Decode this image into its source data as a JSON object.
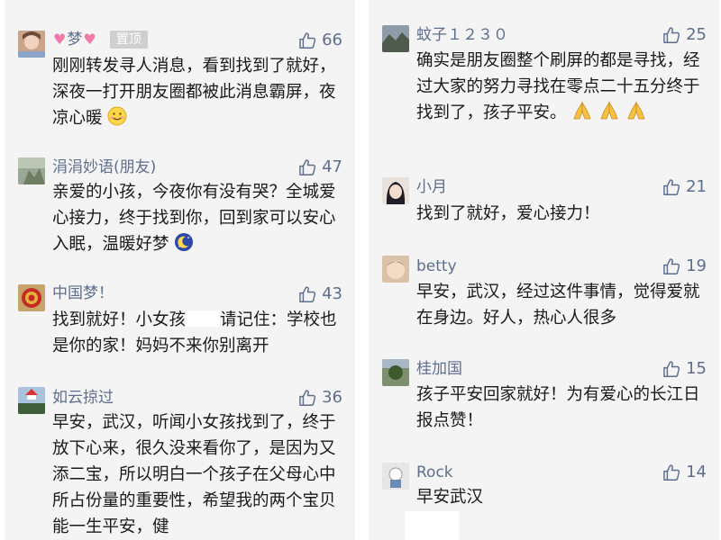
{
  "colors": {
    "panel_bg": "#f4f4f4",
    "name": "#5f6e8c",
    "text": "#1a1a1a",
    "tag_bg": "#cfcfcf",
    "heart": "#f07aa8"
  },
  "left": {
    "comments": [
      {
        "name": "梦",
        "tag": "置顶",
        "likes": "66",
        "text": "刚刚转发寻人消息，看到找到了就好，深夜一打开朋友圈都被此消息霸屏，夜凉心暖",
        "emoji": "smile-emoji"
      },
      {
        "name": "涓涓妙语(朋友)",
        "likes": "47",
        "text": "亲爱的小孩，今夜你有没有哭？全城爱心接力，终于找到你，回到家可以安心入眠，温暖好梦",
        "emoji": "moon-emoji"
      },
      {
        "name": "中国梦！",
        "likes": "43",
        "text_a": "找到就好！小女孩",
        "text_b": "请记住：学校也是你的家！妈妈不来你别离开"
      },
      {
        "name": "如云掠过",
        "likes": "36",
        "text": "早安，武汉，听闻小女孩找到了，终于放下心来，很久没来看你了，是因为又添二宝，所以明白一个孩子在父母心中所占份量的重要性，希望我的两个宝贝能一生平安，健"
      }
    ]
  },
  "right": {
    "comments": [
      {
        "name": "蚊子１２３０",
        "likes": "25",
        "text": "确实是朋友圈整个刷屏的都是寻找，经过大家的努力寻找在零点二十五分终于找到了，孩子平安。",
        "emoji": "pray-emoji"
      },
      {
        "name": "小月",
        "likes": "21",
        "text": "找到了就好，爱心接力！"
      },
      {
        "name": "betty",
        "likes": "19",
        "text": "早安，武汉，经过这件事情，觉得爱就在身边。好人，热心人很多"
      },
      {
        "name": "桂加国",
        "likes": "15",
        "text": "孩子平安回家就好！为有爱心的长江日报点赞！"
      },
      {
        "name": "Rock",
        "likes": "14",
        "text": "早安武汉"
      }
    ]
  }
}
